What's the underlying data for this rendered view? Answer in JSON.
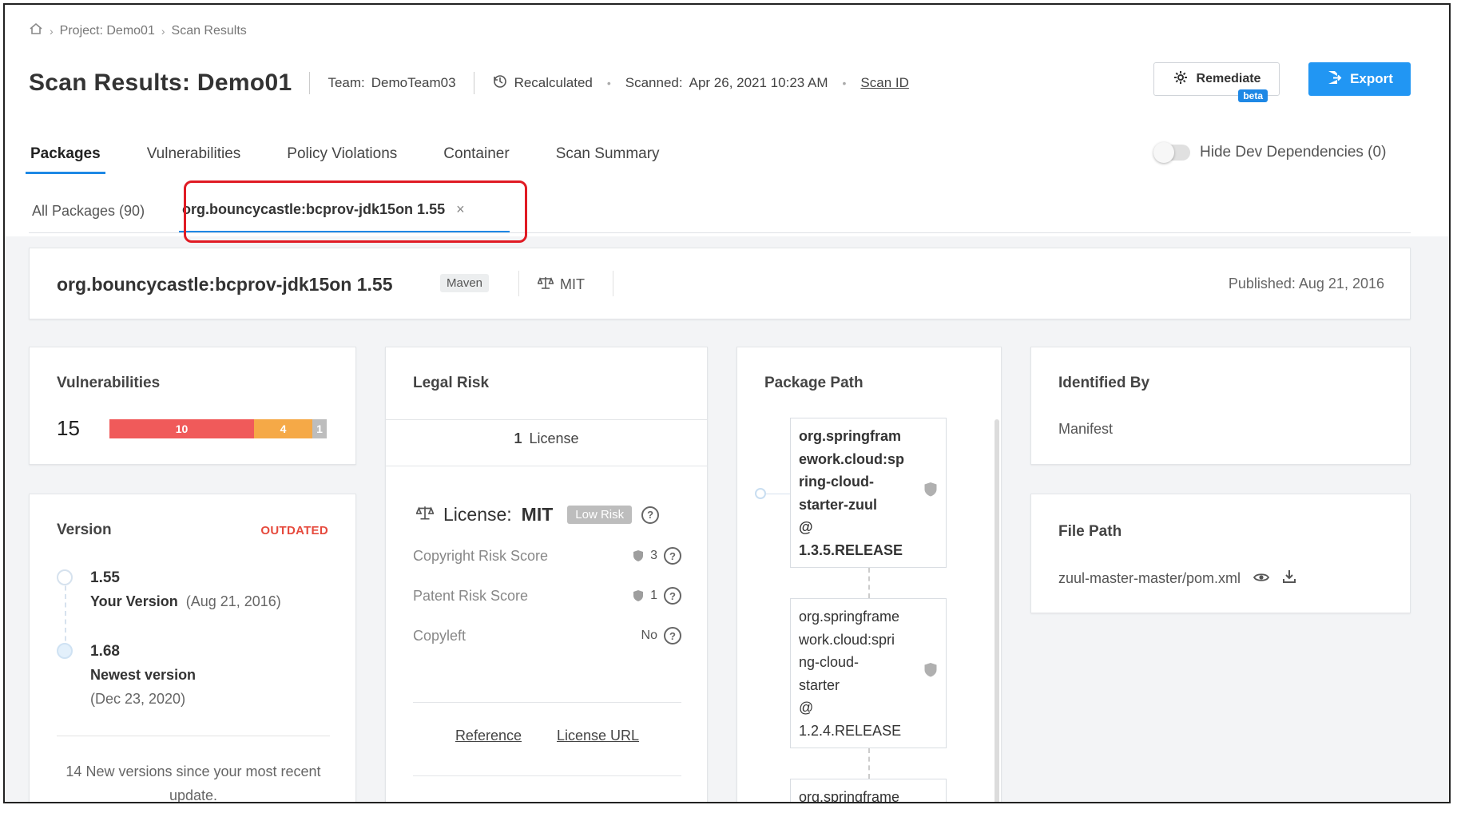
{
  "breadcrumb": {
    "home_icon": "home-icon",
    "items": [
      "Project: Demo01",
      "Scan Results"
    ]
  },
  "header": {
    "title": "Scan Results: Demo01",
    "team_label": "Team:",
    "team_value": "DemoTeam03",
    "recalculated": "Recalculated",
    "scanned_label": "Scanned:",
    "scanned_value": "Apr 26, 2021 10:23 AM",
    "scan_id": "Scan ID"
  },
  "actions": {
    "remediate_label": "Remediate",
    "beta_label": "beta",
    "export_label": "Export",
    "accent": "#2196f3"
  },
  "tabs": [
    {
      "label": "Packages",
      "active": true
    },
    {
      "label": "Vulnerabilities",
      "active": false
    },
    {
      "label": "Policy Violations",
      "active": false
    },
    {
      "label": "Container",
      "active": false
    },
    {
      "label": "Scan Summary",
      "active": false
    }
  ],
  "toggle": {
    "label": "Hide Dev Dependencies (0)",
    "on": false
  },
  "subtabs": {
    "all": "All Packages (90)",
    "active": "org.bouncycastle:bcprov-jdk15on 1.55",
    "close": "×"
  },
  "package": {
    "name": "org.bouncycastle:bcprov-jdk15on 1.55",
    "type": "Maven",
    "license": "MIT",
    "published": "Published: Aug 21, 2016"
  },
  "vulnerabilities": {
    "title": "Vulnerabilities",
    "total": "15",
    "high": "10",
    "medium": "4",
    "low": "1",
    "colors": {
      "high": "#f05a5a",
      "medium": "#f5a947",
      "low": "#bdbdbd"
    }
  },
  "version": {
    "title": "Version",
    "status": "OUTDATED",
    "current": "1.55",
    "current_label": "Your Version",
    "current_date": "(Aug 21, 2016)",
    "newest": "1.68",
    "newest_label": "Newest version",
    "newest_date": "(Dec 23, 2020)",
    "note": "14 New versions since your most recent update."
  },
  "legal": {
    "title": "Legal Risk",
    "license_count_num": "1",
    "license_count_text": "License",
    "license_label": "License:",
    "license_name": "MIT",
    "risk_badge": "Low Risk",
    "rows": [
      {
        "label": "Copyright Risk Score",
        "value": "3"
      },
      {
        "label": "Patent Risk Score",
        "value": "1"
      },
      {
        "label": "Copyleft",
        "value": "No"
      }
    ],
    "reference": "Reference",
    "license_url": "License URL"
  },
  "package_path": {
    "title": "Package Path",
    "nodes": [
      {
        "lines": [
          "org.springfram",
          "ework.cloud:sp",
          "ring-cloud-",
          "starter-zuul",
          "@",
          "1.3.5.RELEASE"
        ]
      },
      {
        "lines": [
          "org.springframe",
          "work.cloud:spri",
          "ng-cloud-",
          "starter",
          "@",
          "1.2.4.RELEASE"
        ]
      },
      {
        "lines": [
          "org.springframe"
        ]
      }
    ]
  },
  "identified_by": {
    "title": "Identified By",
    "value": "Manifest"
  },
  "file_path": {
    "title": "File Path",
    "value": "zuul-master-master/pom.xml"
  }
}
